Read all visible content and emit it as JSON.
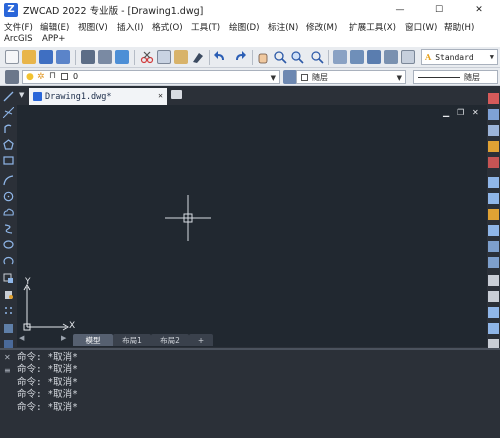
{
  "app": {
    "logo_letter": "Z",
    "title": "ZWCAD 2022 专业版 - [Drawing1.dwg]",
    "window_controls": [
      "—",
      "☐",
      "✕"
    ]
  },
  "menu": {
    "items": [
      "文件(F)",
      "编辑(E)",
      "视图(V)",
      "插入(I)",
      "格式(O)",
      "工具(T)",
      "绘图(D)",
      "标注(N)",
      "修改(M)",
      "扩展工具(X)",
      "窗口(W)",
      "帮助(H)",
      "ArcGIS",
      "APP+"
    ]
  },
  "toolbar": {
    "text_style": "Standard",
    "text_style_icon": "A"
  },
  "properties_bar": {
    "layer_name": "0",
    "color": "随层",
    "linetype": "随层"
  },
  "document": {
    "tab_label": "Drawing1.dwg*",
    "close_glyph": "✕",
    "viewport_controls": [
      "▁",
      "❐",
      "✕"
    ]
  },
  "ucs": {
    "x_label": "X",
    "y_label": "Y"
  },
  "layout_tabs": [
    "模型",
    "布局1",
    "布局2",
    "+"
  ],
  "command_history": [
    "命令: *取消*",
    "命令: *取消*",
    "命令: *取消*",
    "命令: *取消*",
    "命令: *取消*"
  ],
  "colors": {
    "canvas": "#212830",
    "chrome_dark": "#2b3038",
    "accent_blue": "#2a66d9",
    "crosshair": "#d8dce2"
  }
}
